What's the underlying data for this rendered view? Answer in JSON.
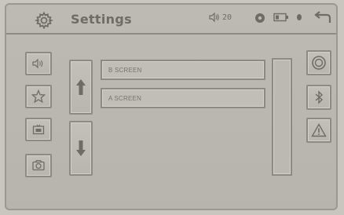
{
  "header": {
    "title": "Settings",
    "volume_level": "20"
  },
  "icons": {
    "header": [
      "gear-icon",
      "speaker-icon",
      "record-dot-icon",
      "battery-icon",
      "small-dot-icon",
      "back-icon"
    ],
    "left_column": [
      "speaker-icon",
      "star-icon",
      "screen-icon",
      "camera-mode-icon"
    ],
    "arrows": [
      "arrow-up-icon",
      "arrow-down-icon"
    ],
    "right_column": [
      "steering-wheel-icon",
      "bluetooth-icon",
      "warning-icon"
    ]
  },
  "list": {
    "items": [
      {
        "label": "B SCREEN"
      },
      {
        "label": "A SCREEN"
      }
    ]
  },
  "colors": {
    "background": "#bdbab3",
    "border": "#8d8a83",
    "text": "#6f6c66"
  }
}
